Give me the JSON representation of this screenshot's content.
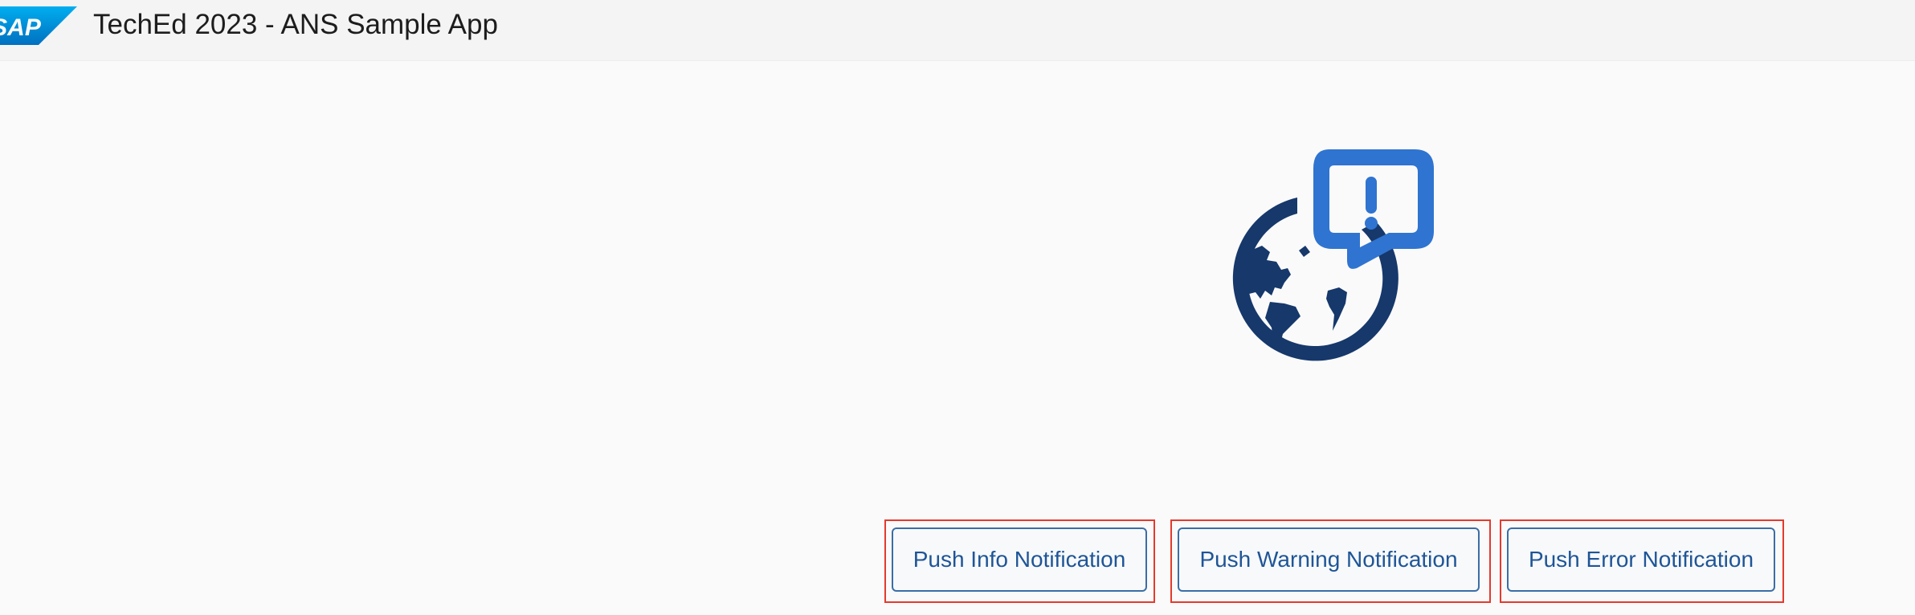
{
  "shell": {
    "logo_text": "SAP",
    "title": "TechEd 2023 - ANS Sample App"
  },
  "illustration": {
    "icon": "globe-notification-illustration",
    "colors": {
      "globe": "#16386b",
      "bubble": "#2f74d0"
    }
  },
  "actions": {
    "info_label": "Push Info Notification",
    "warning_label": "Push Warning Notification",
    "error_label": "Push Error Notification"
  },
  "colors": {
    "button_text": "#1f5596",
    "button_border": "#3b6ea5",
    "highlight": "#e43a2d",
    "background": "#fafafa"
  }
}
